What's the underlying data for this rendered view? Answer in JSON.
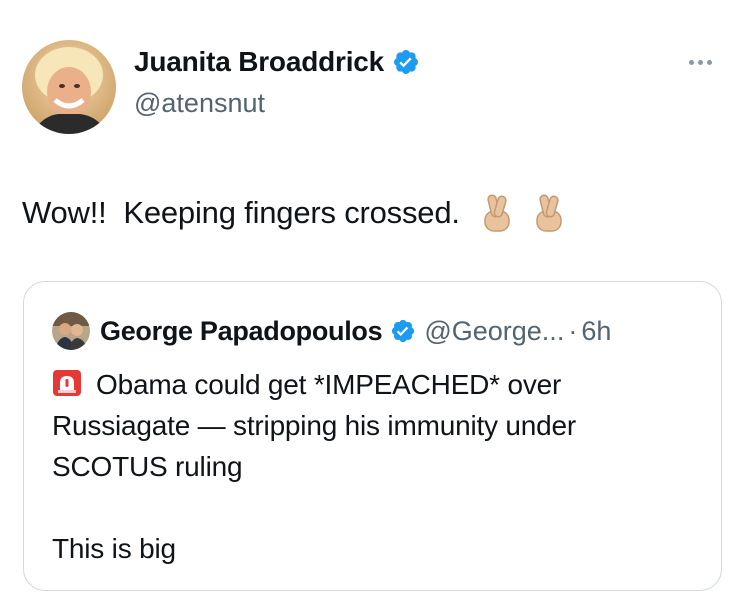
{
  "tweet": {
    "author": {
      "display_name": "Juanita Broaddrick",
      "handle": "@atensnut",
      "verified": true,
      "avatar_icon": "profile-photo-icon"
    },
    "text": "Wow!!  Keeping fingers crossed.",
    "emojis": [
      "🤞🏼",
      "🤞🏼"
    ],
    "more_icon": "more-options-icon"
  },
  "quote": {
    "author": {
      "display_name": "George Papadopoulos",
      "handle": "@George...",
      "verified": true,
      "avatar_icon": "profile-photo-icon"
    },
    "separator": "·",
    "time": "6h",
    "siren_icon": "🚨",
    "lines": [
      "Obama could get *IMPEACHED* over",
      "Russiagate — stripping his immunity under",
      "SCOTUS ruling"
    ],
    "closing_line": "This is big"
  },
  "colors": {
    "text": "#0f1419",
    "secondary": "#536471",
    "verified": "#1d9bf0",
    "border": "#cfd9de"
  }
}
